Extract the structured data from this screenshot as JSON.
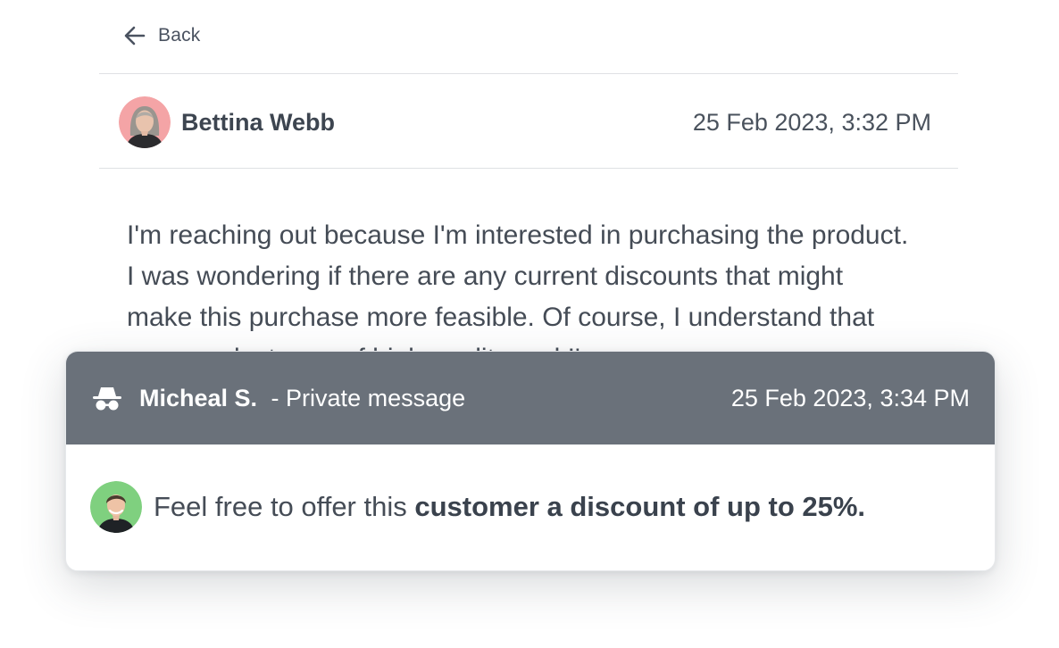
{
  "back": {
    "label": "Back"
  },
  "conversation": {
    "author": "Bettina Webb",
    "timestamp": "25 Feb 2023, 3:32 PM",
    "message": "I'm reaching out because I'm interested in purchasing the product. I was wondering if there are any current discounts that might make this purchase more feasible. Of course, I understand that your products are of high quality and I'm"
  },
  "private_note": {
    "sender": "Micheal S.",
    "separator": " - ",
    "label": "Private message",
    "timestamp": "25 Feb 2023, 3:34 PM",
    "text_plain": "Feel free to offer this ",
    "text_bold": "customer a discount of up to 25%."
  },
  "colors": {
    "text": "#454c56",
    "note_header_bg": "#6a717a",
    "avatar1_bg": "#f4a4a6",
    "avatar2_bg": "#7fd07f"
  },
  "icons": {
    "back": "arrow-left-icon",
    "private": "incognito-spy-icon"
  }
}
